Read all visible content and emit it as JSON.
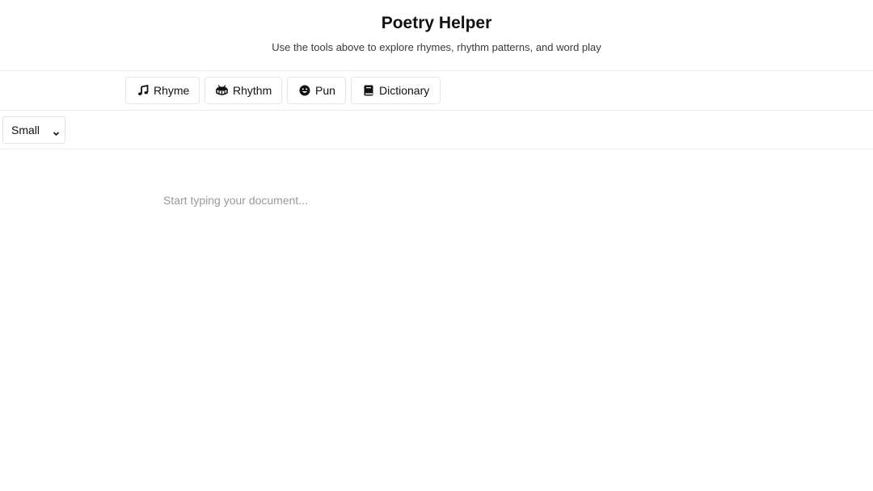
{
  "header": {
    "title": "Poetry Helper",
    "subtitle": "Use the tools above to explore rhymes, rhythm patterns, and word play"
  },
  "toolbar": {
    "buttons": [
      {
        "label": "Rhyme",
        "icon": "music-note-icon"
      },
      {
        "label": "Rhythm",
        "icon": "drum-icon"
      },
      {
        "label": "Pun",
        "icon": "smiley-icon"
      },
      {
        "label": "Dictionary",
        "icon": "book-icon"
      }
    ]
  },
  "format_bar": {
    "size_select": {
      "selected": "Small"
    }
  },
  "editor": {
    "placeholder": "Start typing your document..."
  }
}
